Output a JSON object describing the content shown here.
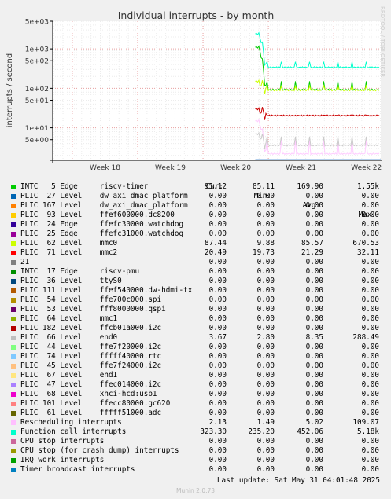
{
  "chart_data": {
    "type": "line",
    "title": "Individual interrupts - by month",
    "ylabel": "interrupts / second",
    "watermark": "RRDTOOL / TOBI OETIKER",
    "y_scale": "log",
    "ylim": [
      1.5,
      5000
    ],
    "y_ticks": [
      {
        "value": 5000,
        "label": "5e+03"
      },
      {
        "value": 1000,
        "label": "1e+03"
      },
      {
        "value": 500,
        "label": "5e+02"
      },
      {
        "value": 100,
        "label": "1e+02"
      },
      {
        "value": 50,
        "label": "5e+01"
      },
      {
        "value": 10,
        "label": "1e+01"
      },
      {
        "value": 5,
        "label": "5e+00"
      }
    ],
    "x_range_weeks": [
      17.7,
      22.72
    ],
    "x_ticks": [
      {
        "week": 18,
        "label": "Week 18"
      },
      {
        "week": 19,
        "label": "Week 19"
      },
      {
        "week": 20,
        "label": "Week 20"
      },
      {
        "week": 21,
        "label": "Week 21"
      },
      {
        "week": 22,
        "label": "Week 22"
      }
    ],
    "data_start_week": 20.8,
    "grid": true,
    "series_plot": [
      {
        "name": "Function call interrupts",
        "color": "#00FFCC",
        "start": 2400,
        "base": 340,
        "spike": 470
      },
      {
        "name": "INTC   5 Edge     riscv-timer",
        "color": "#00CC00",
        "start": 1100,
        "base": 92,
        "spike": 150
      },
      {
        "name": "PLIC  62 Level    mmc0",
        "color": "#CCFF00",
        "start": 150,
        "base": 90,
        "spike": 115
      },
      {
        "name": "PLIC  71 Level    mmc2",
        "color": "#CC0000",
        "start": 30,
        "base": 20.5,
        "spike": 21
      },
      {
        "name": "Rescheduling interrupts",
        "color": "#FFCCFF",
        "start": 15,
        "base": 2.2,
        "spike": 5
      },
      {
        "name": "PLIC  66 Level    end0",
        "color": "#CCCCCC",
        "start": 7,
        "base": 3.6,
        "spike": 6
      }
    ],
    "columns": [
      "Cur:",
      "Min:",
      "Avg:",
      "Max:"
    ],
    "series": [
      {
        "name": "INTC   5 Edge     riscv-timer",
        "color": "#00CC00",
        "cur": "95.12",
        "min": "85.11",
        "avg": "169.90",
        "max": "1.55k"
      },
      {
        "name": "PLIC  27 Level    dw_axi_dmac_platform",
        "color": "#0066B3",
        "cur": "0.00",
        "min": "0.00",
        "avg": "0.00",
        "max": "0.00"
      },
      {
        "name": "PLIC 167 Level    dw_axi_dmac_platform",
        "color": "#FF8000",
        "cur": "0.00",
        "min": "0.00",
        "avg": "0.00",
        "max": "0.00"
      },
      {
        "name": "PLIC  93 Level    ffef600000.dc8200",
        "color": "#FFCC00",
        "cur": "0.00",
        "min": "0.00",
        "avg": "0.00",
        "max": "0.00"
      },
      {
        "name": "PLIC  24 Edge     ffefc30000.watchdog",
        "color": "#330099",
        "cur": "0.00",
        "min": "0.00",
        "avg": "0.00",
        "max": "0.00"
      },
      {
        "name": "PLIC  25 Edge     ffefc31000.watchdog",
        "color": "#990099",
        "cur": "0.00",
        "min": "0.00",
        "avg": "0.00",
        "max": "0.00"
      },
      {
        "name": "PLIC  62 Level    mmc0",
        "color": "#CCFF00",
        "cur": "87.44",
        "min": "9.88",
        "avg": "85.57",
        "max": "670.53"
      },
      {
        "name": "PLIC  71 Level    mmc2",
        "color": "#FF0000",
        "cur": "20.49",
        "min": "19.73",
        "avg": "21.29",
        "max": "32.11"
      },
      {
        "name": "21",
        "color": "#808080",
        "cur": "0.00",
        "min": "0.00",
        "avg": "0.00",
        "max": "0.00"
      },
      {
        "name": "INTC  17 Edge     riscv-pmu",
        "color": "#008F00",
        "cur": "0.00",
        "min": "0.00",
        "avg": "0.00",
        "max": "0.00"
      },
      {
        "name": "PLIC  36 Level    ttyS0",
        "color": "#00487D",
        "cur": "0.00",
        "min": "0.00",
        "avg": "0.00",
        "max": "0.00"
      },
      {
        "name": "PLIC 111 Level    ffef540000.dw-hdmi-tx",
        "color": "#B35A00",
        "cur": "0.00",
        "min": "0.00",
        "avg": "0.00",
        "max": "0.00"
      },
      {
        "name": "PLIC  54 Level    ffe700c000.spi",
        "color": "#B38F00",
        "cur": "0.00",
        "min": "0.00",
        "avg": "0.00",
        "max": "0.00"
      },
      {
        "name": "PLIC  53 Level    fff8000000.qspi",
        "color": "#6B006B",
        "cur": "0.00",
        "min": "0.00",
        "avg": "0.00",
        "max": "0.00"
      },
      {
        "name": "PLIC  64 Level    mmc1",
        "color": "#8FB300",
        "cur": "0.00",
        "min": "0.00",
        "avg": "0.00",
        "max": "0.00"
      },
      {
        "name": "PLIC 182 Level    ffcb01a000.i2c",
        "color": "#B30000",
        "cur": "0.00",
        "min": "0.00",
        "avg": "0.00",
        "max": "0.00"
      },
      {
        "name": "PLIC  66 Level    end0",
        "color": "#BEBEBE",
        "cur": "3.67",
        "min": "2.80",
        "avg": "8.35",
        "max": "288.49"
      },
      {
        "name": "PLIC  44 Level    ffe7f20000.i2c",
        "color": "#80FF80",
        "cur": "0.00",
        "min": "0.00",
        "avg": "0.00",
        "max": "0.00"
      },
      {
        "name": "PLIC  74 Level    fffff40000.rtc",
        "color": "#80C9FF",
        "cur": "0.00",
        "min": "0.00",
        "avg": "0.00",
        "max": "0.00"
      },
      {
        "name": "PLIC  45 Level    ffe7f24000.i2c",
        "color": "#FFC080",
        "cur": "0.00",
        "min": "0.00",
        "avg": "0.00",
        "max": "0.00"
      },
      {
        "name": "PLIC  67 Level    end1",
        "color": "#FFE680",
        "cur": "0.00",
        "min": "0.00",
        "avg": "0.00",
        "max": "0.00"
      },
      {
        "name": "PLIC  47 Level    ffec014000.i2c",
        "color": "#AA80FF",
        "cur": "0.00",
        "min": "0.00",
        "avg": "0.00",
        "max": "0.00"
      },
      {
        "name": "PLIC  68 Level    xhci-hcd:usb1",
        "color": "#EE00CC",
        "cur": "0.00",
        "min": "0.00",
        "avg": "0.00",
        "max": "0.00"
      },
      {
        "name": "PLIC 101 Level    ffecc80000.gc620",
        "color": "#FF8080",
        "cur": "0.00",
        "min": "0.00",
        "avg": "0.00",
        "max": "0.00"
      },
      {
        "name": "PLIC  61 Level    fffff51000.adc",
        "color": "#666600",
        "cur": "0.00",
        "min": "0.00",
        "avg": "0.00",
        "max": "0.00"
      },
      {
        "name": "Rescheduling interrupts",
        "color": "#FFBFFF",
        "cur": "2.13",
        "min": "1.49",
        "avg": "5.02",
        "max": "109.07"
      },
      {
        "name": "Function call interrupts",
        "color": "#00FFCC",
        "cur": "323.30",
        "min": "235.20",
        "avg": "452.06",
        "max": "5.18k"
      },
      {
        "name": "CPU stop interrupts",
        "color": "#CC6699",
        "cur": "0.00",
        "min": "0.00",
        "avg": "0.00",
        "max": "0.00"
      },
      {
        "name": "CPU stop (for crash dump) interrupts",
        "color": "#999900",
        "cur": "0.00",
        "min": "0.00",
        "avg": "0.00",
        "max": "0.00"
      },
      {
        "name": "IRQ work interrupts",
        "color": "#00A000",
        "cur": "0.00",
        "min": "0.00",
        "avg": "0.00",
        "max": "0.00"
      },
      {
        "name": "Timer broadcast interrupts",
        "color": "#0080C0",
        "cur": "0.00",
        "min": "0.00",
        "avg": "0.00",
        "max": "0.00"
      }
    ]
  },
  "footer": {
    "last_update": "Last update: Sat May 31 04:01:48 2025",
    "version": "Munin 2.0.73"
  }
}
